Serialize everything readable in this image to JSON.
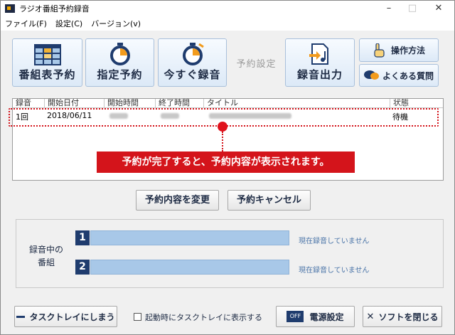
{
  "window": {
    "title": "ラジオ番組予約録音",
    "minimize": "–",
    "maximize": "□",
    "close": "✕"
  },
  "menu": [
    {
      "label": "ファイル(F)"
    },
    {
      "label": "設定(C)"
    },
    {
      "label": "バージョン(v)"
    }
  ],
  "toolbar": {
    "timetable_label": "番組表予約",
    "specified_label": "指定予約",
    "record_now_label": "今すぐ録音",
    "reserve_settings_label": "予約設定",
    "export_label": "録音出力",
    "howto_label": "操作方法",
    "faq_label": "よくある質問"
  },
  "table": {
    "columns": [
      "録音",
      "開始日付",
      "開始時間",
      "終了時間",
      "タイトル",
      "状態"
    ],
    "rows": [
      {
        "rec": "1回",
        "date": "2018/06/11",
        "status": "待機"
      }
    ]
  },
  "callout": "予約が完了すると、予約内容が表示されます。",
  "actions": {
    "change_label": "予約内容を変更",
    "cancel_label": "予約キャンセル"
  },
  "recording": {
    "label_line1": "録音中の",
    "label_line2": "番組",
    "channels": [
      {
        "num": "1",
        "status": "現在録音していません"
      },
      {
        "num": "2",
        "status": "現在録音していません"
      }
    ]
  },
  "footer": {
    "tray_label": "タスクトレイにしまう",
    "startup_tray_label": "起動時にタスクトレイに表示する",
    "power_label": "電源設定",
    "close_label": "ソフトを閉じる",
    "power_icon_text": "OFF"
  },
  "colors": {
    "accent": "#d4141b",
    "navy": "#1f3c6e",
    "bar": "#a8c8e8"
  },
  "icons": [
    "timetable-icon",
    "stopwatch-icon",
    "stopwatch-now-icon",
    "music-export-icon",
    "pointing-hand-icon",
    "faq-bubble-icon",
    "minimize-icon",
    "close-x-icon",
    "power-off-icon"
  ]
}
